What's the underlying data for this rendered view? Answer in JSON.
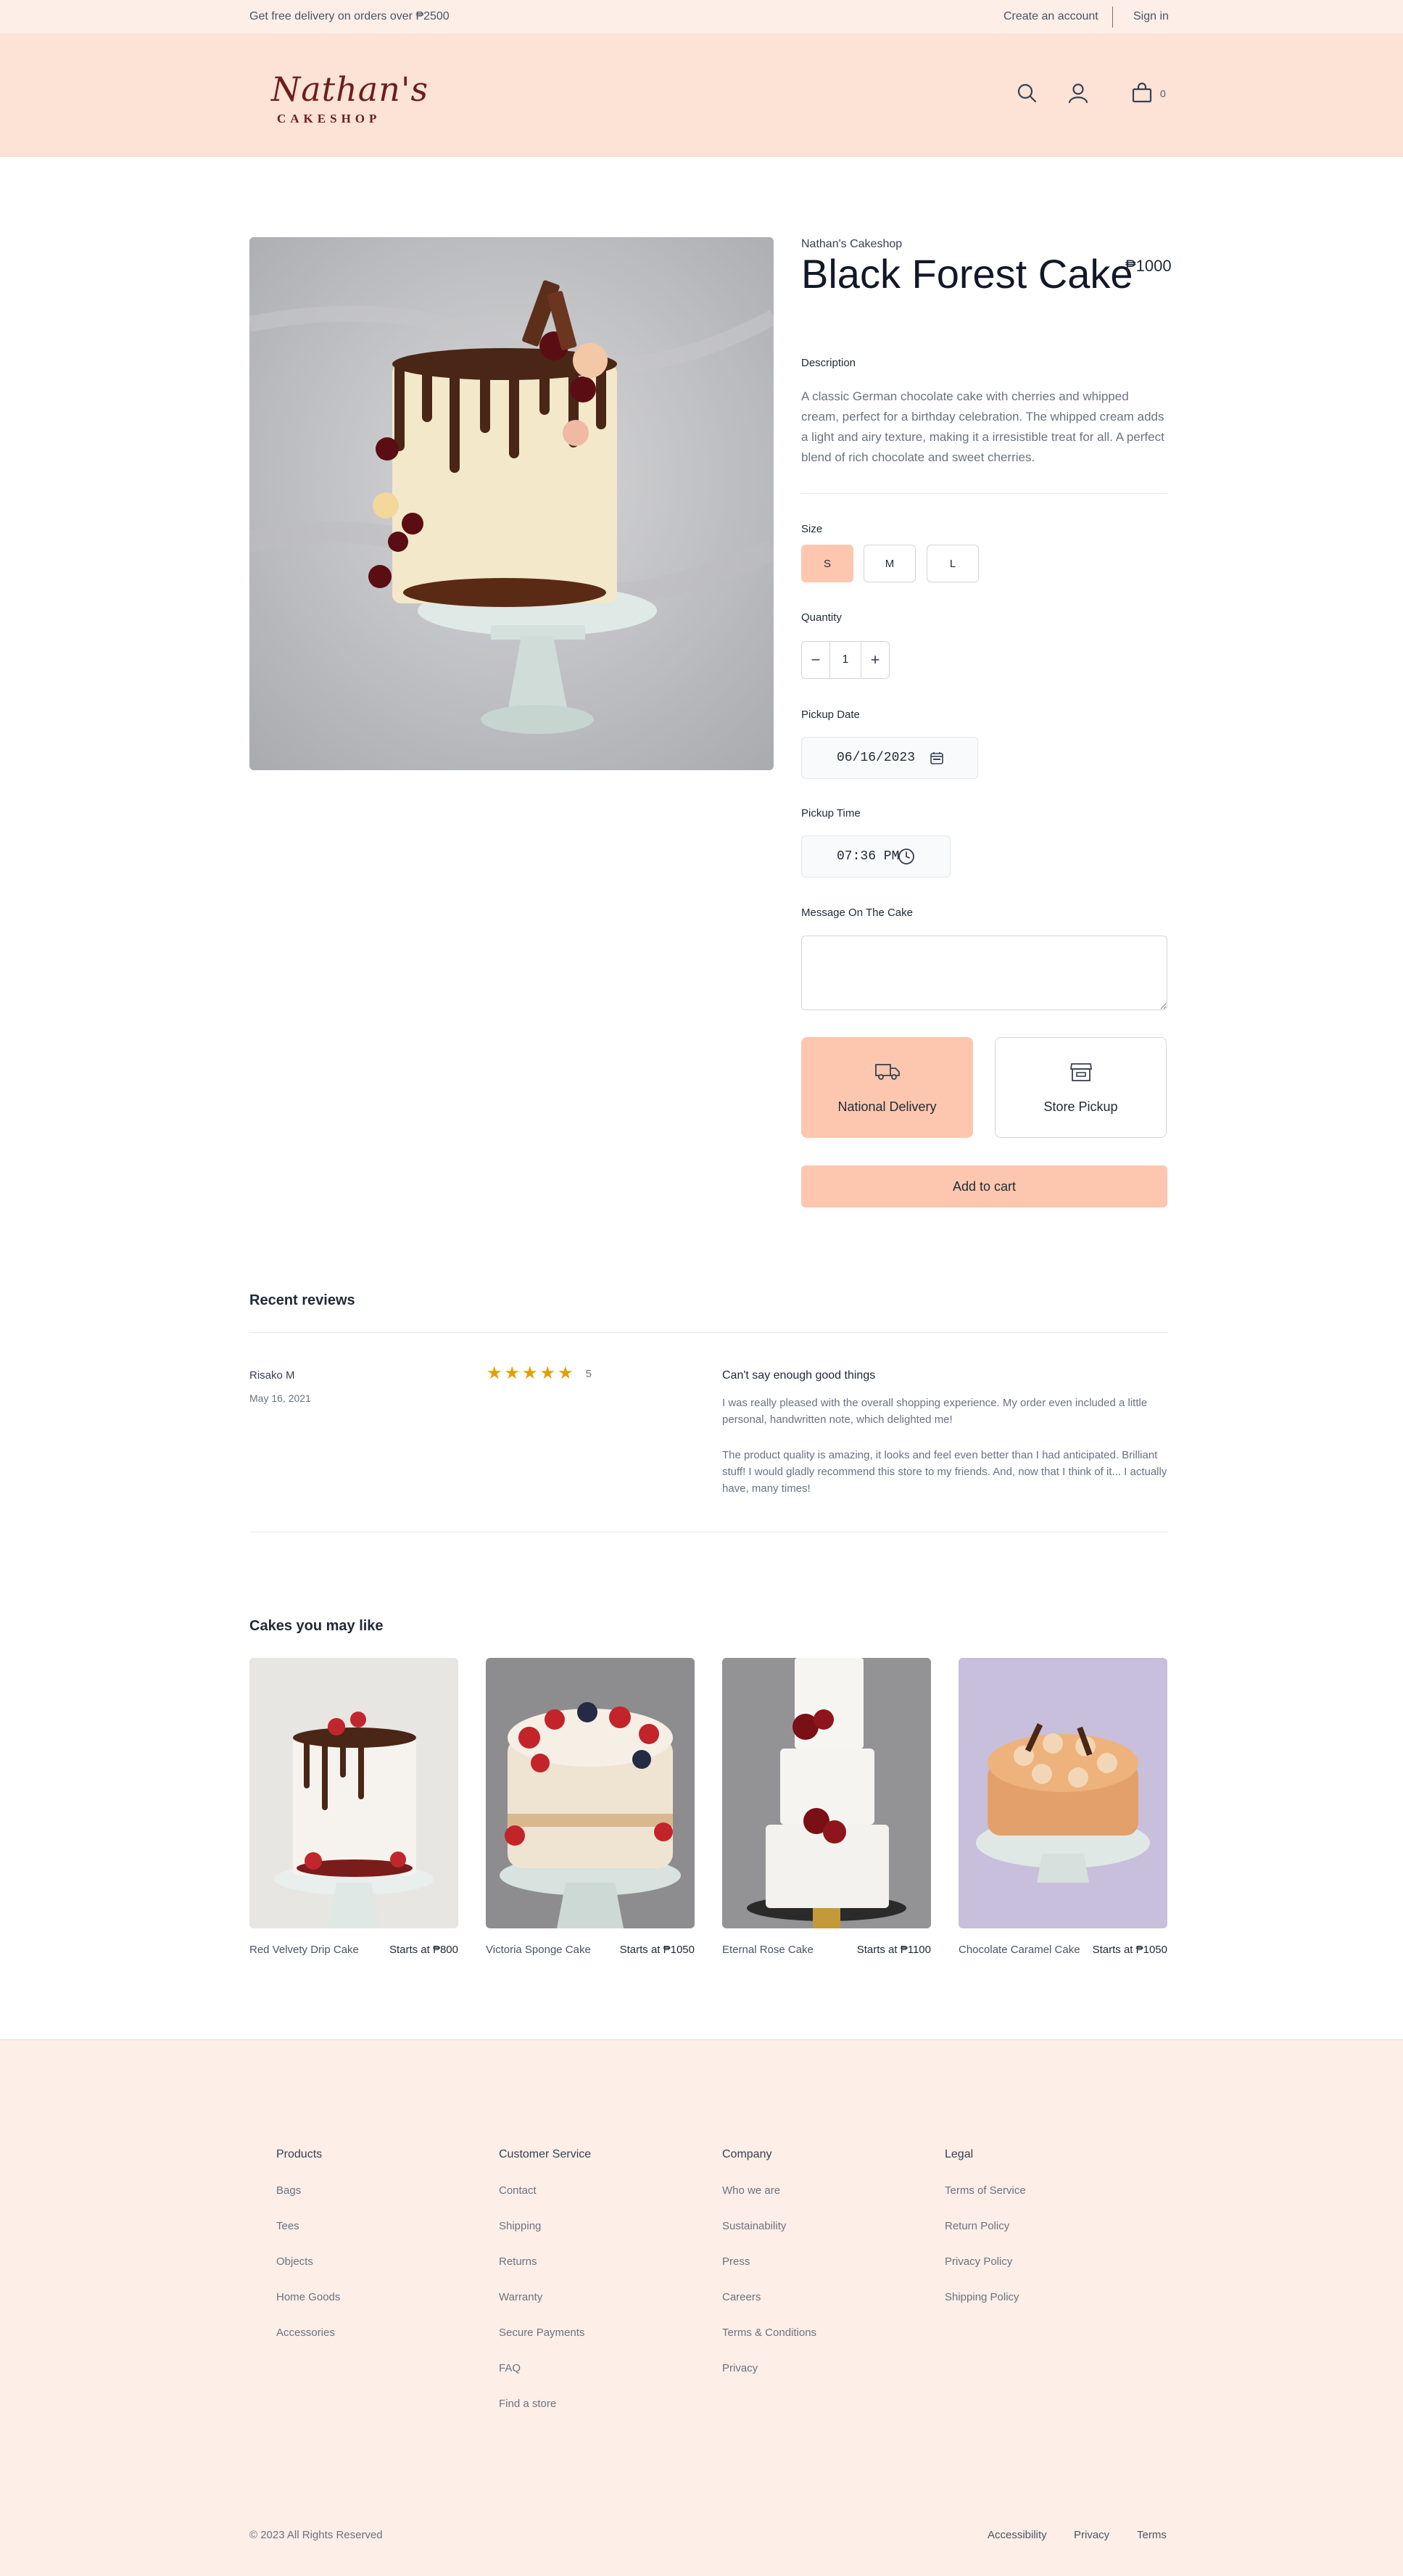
{
  "topbar": {
    "promo": "Get free delivery on orders over ₱2500",
    "create_account": "Create an account",
    "sign_in": "Sign in"
  },
  "header": {
    "logo_script": "Nathan's",
    "logo_sub": "CAKESHOP",
    "cart_count": "0",
    "icons": [
      "search-icon",
      "user-icon",
      "shopping-bag-icon"
    ]
  },
  "product": {
    "brand": "Nathan's Cakeshop",
    "title": "Black Forest Cake",
    "price": "₱1000",
    "description_label": "Description",
    "description": "A classic German chocolate cake with cherries and whipped cream, perfect for a birthday celebration. The whipped cream adds a light and airy texture, making it a irresistible treat for all. A perfect blend of rich chocolate and sweet cherries.",
    "size_label": "Size",
    "sizes": [
      "S",
      "M",
      "L"
    ],
    "selected_size": "S",
    "quantity_label": "Quantity",
    "quantity": "1",
    "qty_minus": "−",
    "qty_plus": "+",
    "pickup_date_label": "Pickup Date",
    "pickup_date": "06/16/2023",
    "pickup_time_label": "Pickup Time",
    "pickup_time": "07:36 PM",
    "message_label": "Message On The Cake",
    "message_value": "",
    "delivery_options": [
      "National Delivery",
      "Store Pickup"
    ],
    "selected_delivery": "National Delivery",
    "add_to_cart": "Add to cart"
  },
  "reviews": {
    "title": "Recent reviews",
    "items": [
      {
        "name": "Risako M",
        "date": "May 16, 2021",
        "rating": 5,
        "rating_text": "5",
        "headline": "Can't say enough good things",
        "paragraphs": [
          "I was really pleased with the overall shopping experience. My order even included a little personal, handwritten note, which delighted me!",
          "The product quality is amazing, it looks and feel even better than I had anticipated. Brilliant stuff! I would gladly recommend this store to my friends. And, now that I think of it... I actually have, many times!"
        ]
      }
    ]
  },
  "recommendations": {
    "title": "Cakes you may like",
    "items": [
      {
        "name": "Red Velvety Drip Cake",
        "price": "Starts at ₱800"
      },
      {
        "name": "Victoria Sponge Cake",
        "price": "Starts at ₱1050"
      },
      {
        "name": "Eternal Rose Cake",
        "price": "Starts at ₱1100"
      },
      {
        "name": "Chocolate Caramel Cake",
        "price": "Starts at ₱1050"
      }
    ]
  },
  "footer": {
    "columns": [
      {
        "title": "Products",
        "items": [
          "Bags",
          "Tees",
          "Objects",
          "Home Goods",
          "Accessories"
        ]
      },
      {
        "title": "Customer Service",
        "items": [
          "Contact",
          "Shipping",
          "Returns",
          "Warranty",
          "Secure Payments",
          "FAQ",
          "Find a store"
        ]
      },
      {
        "title": "Company",
        "items": [
          "Who we are",
          "Sustainability",
          "Press",
          "Careers",
          "Terms & Conditions",
          "Privacy"
        ]
      },
      {
        "title": "Legal",
        "items": [
          "Terms of Service",
          "Return Policy",
          "Privacy Policy",
          "Shipping Policy"
        ]
      }
    ],
    "copyright": "© 2023 All Rights Reserved",
    "bottom_links": [
      "Accessibility",
      "Privacy",
      "Terms"
    ]
  },
  "colors": {
    "topbar_bg": "#fdeee8",
    "header_bg": "#fde2d6",
    "accent": "#fcc7ae",
    "star": "#e0a100",
    "logo": "#6b1f1a"
  }
}
